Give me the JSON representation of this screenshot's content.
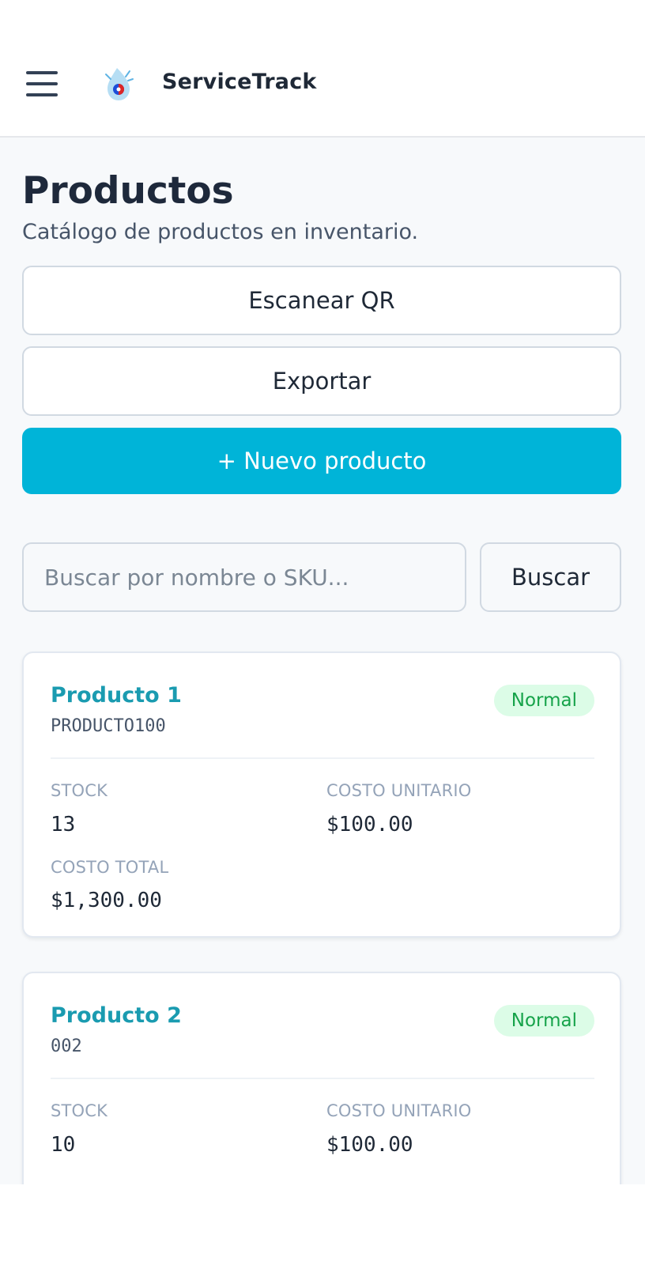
{
  "header": {
    "app_title": "ServiceTrack",
    "menu_icon": "hamburger-menu-icon",
    "logo_icon": "water-drop-logo"
  },
  "page": {
    "title": "Productos",
    "subtitle": "Catálogo de productos en inventario."
  },
  "actions": {
    "scan_qr_label": "Escanear QR",
    "export_label": "Exportar",
    "new_product_label": "+ Nuevo producto"
  },
  "search": {
    "placeholder": "Buscar por nombre o SKU...",
    "value": "",
    "button_label": "Buscar"
  },
  "products": [
    {
      "name": "Producto 1",
      "sku": "PRODUCTO100",
      "status": "Normal",
      "stock_label": "STOCK",
      "stock": "13",
      "unit_cost_label": "COSTO UNITARIO",
      "unit_cost": "$100.00",
      "total_cost_label": "COSTO TOTAL",
      "total_cost": "$1,300.00"
    },
    {
      "name": "Producto 2",
      "sku": "002",
      "status": "Normal",
      "stock_label": "STOCK",
      "stock": "10",
      "unit_cost_label": "COSTO UNITARIO",
      "unit_cost": "$100.00"
    }
  ],
  "colors": {
    "primary": "#00b4d8",
    "product_link": "#1a9bb0",
    "badge_background": "#dcfce7",
    "badge_text": "#16a34a",
    "page_background": "#f7f9fb"
  }
}
